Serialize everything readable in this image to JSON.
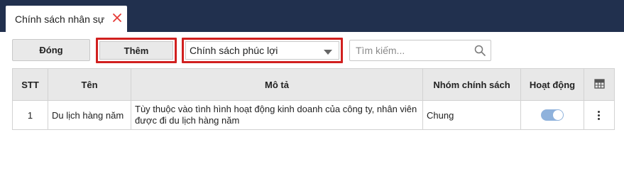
{
  "tab": {
    "label": "Chính sách nhân sự"
  },
  "toolbar": {
    "close_label": "Đóng",
    "add_label": "Thêm",
    "policy_select": {
      "selected": "Chính sách phúc lợi"
    },
    "search": {
      "placeholder": "Tìm kiếm..."
    }
  },
  "table": {
    "headers": {
      "index": "STT",
      "name": "Tên",
      "description": "Mô tả",
      "group": "Nhóm chính sách",
      "active": "Hoạt động"
    },
    "rows": [
      {
        "index": "1",
        "name": "Du lịch hàng năm",
        "description": "Tùy thuộc vào tình hình hoạt động kinh doanh của công ty, nhân viên được đi du lịch hàng năm",
        "group": "Chung",
        "active": true
      }
    ]
  },
  "colors": {
    "tabbar": "#21304e",
    "highlight_border": "#d1201f",
    "close_x": "#e53935",
    "toggle_on": "#8fb2dc",
    "header_bg": "#e8e8e8"
  },
  "icons": {
    "tab_close": "close-icon",
    "select_caret": "caret-down-icon",
    "search": "search-icon",
    "column_settings": "table-grid-icon",
    "row_menu": "more-vertical-icon"
  }
}
